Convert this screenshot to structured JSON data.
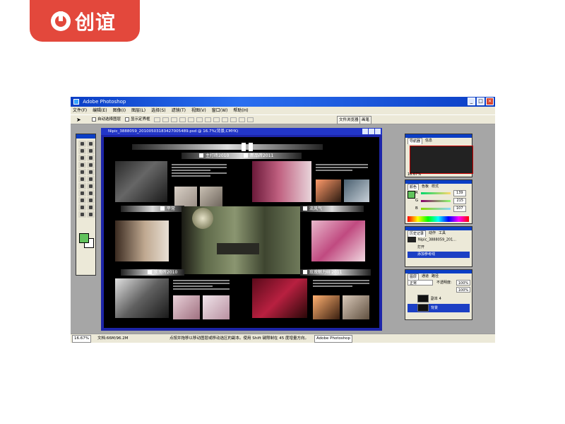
{
  "brand": {
    "name": "创谊"
  },
  "window": {
    "title": "Adobe Photoshop",
    "controls": [
      "_",
      "□",
      "×"
    ]
  },
  "menu": [
    "文件(F)",
    "编辑(E)",
    "图像(I)",
    "图层(L)",
    "选择(S)",
    "滤镜(T)",
    "视图(V)",
    "窗口(W)",
    "帮助(H)"
  ],
  "options": {
    "auto_select_layer": "自动选择图层",
    "show_bounding_box": "显示定界框",
    "file_browser": "文件浏览器",
    "brushes": "画笔"
  },
  "document": {
    "title": "Nipic_3888059_20100503183427005489.psd @ 16.7%(背景,CMYK)",
    "sections": {
      "s1": "主打砖2010",
      "s2": "新品砖2011",
      "s3": "平常",
      "s4": "流风气",
      "s5": "玫瑰砖2010",
      "s6": "玫瑰魅力III 2011"
    }
  },
  "panels": {
    "navigator": {
      "tabs": [
        "导航器",
        "信息"
      ],
      "zoom": "16.67%"
    },
    "color": {
      "tabs": [
        "颜色",
        "色板",
        "样式"
      ],
      "channels": [
        {
          "name": "R",
          "value": "139"
        },
        {
          "name": "G",
          "value": "215"
        },
        {
          "name": "B",
          "value": "107"
        }
      ],
      "foreground": "#62c25c"
    },
    "history": {
      "tabs": [
        "历史记录",
        "动作",
        "工具"
      ],
      "snapshot": "Nipic_3888059_201...",
      "items": [
        "打开",
        "添加参考线"
      ]
    },
    "layers": {
      "tabs": [
        "图层",
        "通道",
        "路径"
      ],
      "blend_mode": "正常",
      "opacity_label": "不透明度:",
      "opacity": "100%",
      "fill": "100%",
      "items": [
        {
          "name": "副本 4"
        },
        {
          "name": "背景"
        }
      ]
    }
  },
  "status": {
    "zoom": "16.67%",
    "doc": "文档:66M/96.2M",
    "hint": "点按并拖移以移动图层或移动选区的副本。使用 Shift 键限制在 45 度增量方向。",
    "app": "Adobe Photoshop"
  }
}
